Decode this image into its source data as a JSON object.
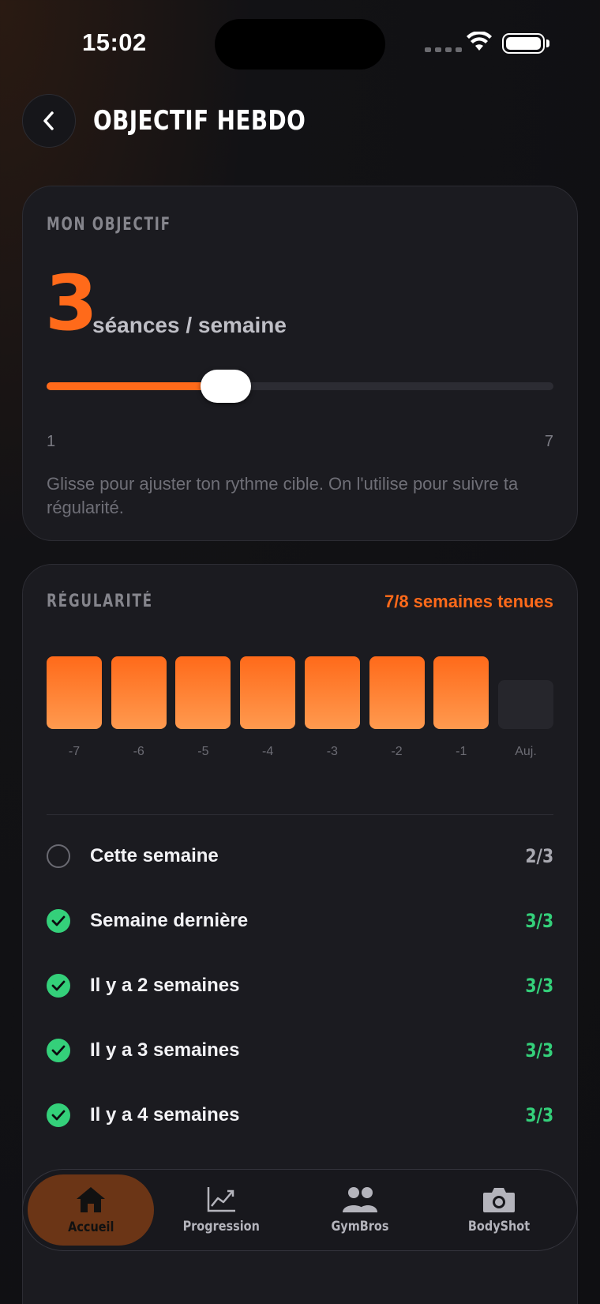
{
  "status_bar": {
    "time": "15:02"
  },
  "header": {
    "title": "OBJECTIF HEBDO"
  },
  "goal_card": {
    "section_label": "MON OBJECTIF",
    "value": "3",
    "unit": "séances / semaine",
    "slider": {
      "min_label": "1",
      "max_label": "7",
      "min": 1,
      "max": 7,
      "value": 3
    },
    "helper_text": "Glisse pour ajuster ton rythme cible. On l'utilise pour suivre ta régularité."
  },
  "regularity_card": {
    "section_label": "RÉGULARITÉ",
    "summary": "7/8 semaines tenues",
    "bars": [
      {
        "label": "-7",
        "done": true
      },
      {
        "label": "-6",
        "done": true
      },
      {
        "label": "-5",
        "done": true
      },
      {
        "label": "-4",
        "done": true
      },
      {
        "label": "-3",
        "done": true
      },
      {
        "label": "-2",
        "done": true
      },
      {
        "label": "-1",
        "done": true
      },
      {
        "label": "Auj.",
        "done": false
      }
    ],
    "weeks": [
      {
        "label": "Cette semaine",
        "score": "2/3",
        "done": false
      },
      {
        "label": "Semaine dernière",
        "score": "3/3",
        "done": true
      },
      {
        "label": "Il y a 2 semaines",
        "score": "3/3",
        "done": true
      },
      {
        "label": "Il y a 3 semaines",
        "score": "3/3",
        "done": true
      },
      {
        "label": "Il y a 4 semaines",
        "score": "3/3",
        "done": true
      }
    ]
  },
  "tabbar": {
    "tabs": [
      {
        "label": "Accueil",
        "icon": "home-icon",
        "active": true
      },
      {
        "label": "Progression",
        "icon": "chart-icon",
        "active": false
      },
      {
        "label": "GymBros",
        "icon": "people-icon",
        "active": false
      },
      {
        "label": "BodyShot",
        "icon": "camera-icon",
        "active": false
      }
    ]
  },
  "colors": {
    "accent": "#ff6a1a",
    "success": "#34d07a",
    "card": "#1b1b20",
    "background": "#111114"
  }
}
